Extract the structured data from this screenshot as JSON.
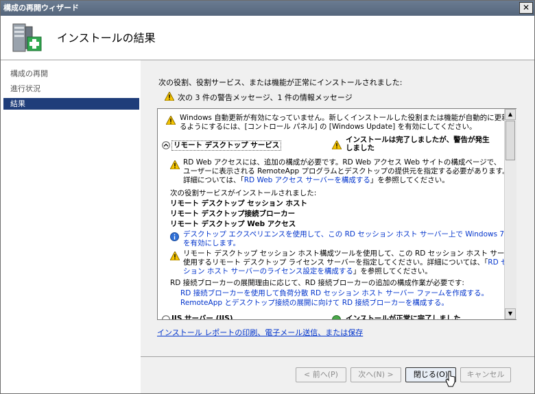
{
  "window": {
    "title": "構成の再開ウィザード",
    "close": "✕"
  },
  "header": {
    "title": "インストールの結果"
  },
  "sidebar": {
    "items": [
      {
        "label": "構成の再開"
      },
      {
        "label": "進行状況"
      },
      {
        "label": "結果"
      }
    ]
  },
  "main": {
    "intro": "次の役割、役割サービス、または機能が正常にインストールされました:",
    "summary": "次の 3 件の警告メッセージ、1 件の情報メッセージ",
    "details": {
      "update_warning_1": "Windows 自動更新が有効になっていません。新しくインストールした役割または機能が自動的に更新さ",
      "update_warning_2": "るようにするには、[コントロール パネル] の [Windows Update] を有効にしてください。",
      "role_toggle": "リモート デスクトップ サービス",
      "role_status_1": "インストールは完了しましたが、警告が発生",
      "role_status_2": "しました",
      "rdweb_1": "RD Web アクセスには、追加の構成が必要です。RD Web アクセス Web サイトの構成ページで、",
      "rdweb_2": "ユーザーに表示される RemoteApp プログラムとデスクトップの提供元を指定する必要があります。",
      "rdweb_3a": "詳細については、「",
      "rdweb_3_link": "RD Web アクセス サーバーを構成する",
      "rdweb_3b": "」を参照してください。",
      "installed_header": "次の役割サービスがインストールされました:",
      "svc_1": "リモート デスクトップ セッション ホスト",
      "svc_2": "リモート デスクトップ接続ブローカー",
      "svc_3": "リモート デスクトップ Web アクセス",
      "desktop_exp_1": "デスクトップ エクスペリエンスを使用して、この RD セッション ホスト サーバー上で Windows 7 の機能",
      "desktop_exp_2": "を有効にします。",
      "license_1": "リモート デスクトップ セッション ホスト構成ツールを使用して、この RD セッション ホスト サーバーで",
      "license_2a": "使用するリモート デスクトップ ライセンス サーバーを指定してください。詳細については、「",
      "license_2_link": "RD セッ",
      "license_3_link": "ション ホスト サーバーのライセンス設定を構成する",
      "license_3b": "」を参照してください。",
      "broker_header": "RD 接続ブローカーの展開理由に応じて、RD 接続ブローカーの追加の構成作業が必要です:",
      "broker_link_1": "RD 接続ブローカーを使用して負荷分散 RD セッション ホスト サーバー ファームを作成する。",
      "broker_link_2": "RemoteApp とデスクトップ接続の展開に向けて RD 接続ブローカーを構成する。",
      "cut_left": "IIS サーバー (IIS)",
      "cut_right": "インストールが正常に完了しました"
    },
    "report_link": "インストール レポートの印刷、電子メール送信、または保存"
  },
  "buttons": {
    "prev": "< 前へ(P)",
    "next": "次へ(N) >",
    "close": "閉じる(O)",
    "cancel": "キャンセル"
  },
  "colors": {
    "selection": "#1f3d7a",
    "link": "#0033cc",
    "warning": "#f5c400"
  }
}
